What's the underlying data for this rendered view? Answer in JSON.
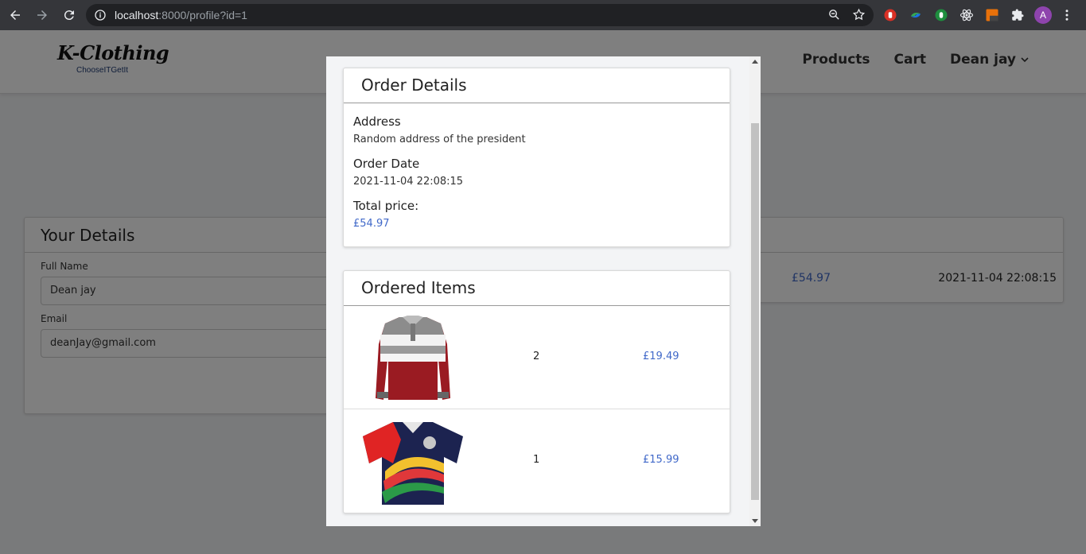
{
  "browser": {
    "url_host": "localhost",
    "url_rest": ":8000/profile?id=1",
    "avatar_letter": "A"
  },
  "site": {
    "logo_text": "K-Clothing",
    "logo_tagline": "ChooseITGetIt",
    "nav": {
      "products": "Products",
      "cart": "Cart",
      "user": "Dean jay"
    }
  },
  "your_details": {
    "title": "Your Details",
    "full_name_label": "Full Name",
    "full_name_value": "Dean jay",
    "email_label": "Email",
    "email_value": "deanJay@gmail.com"
  },
  "orders_table": {
    "row_price": "£54.97",
    "row_date": "2021-11-04 22:08:15"
  },
  "modal": {
    "order_details": {
      "title": "Order Details",
      "address_label": "Address",
      "address_value": "Random address of the president",
      "date_label": "Order Date",
      "date_value": "2021-11-04 22:08:15",
      "total_label": "Total price:",
      "total_value": "£54.97"
    },
    "ordered_items": {
      "title": "Ordered Items",
      "items": [
        {
          "qty": "2",
          "price": "£19.49"
        },
        {
          "qty": "1",
          "price": "£15.99"
        }
      ]
    }
  },
  "colors": {
    "accent_link": "#4169c9",
    "chrome_bg": "#35363a",
    "overlay": "rgba(0,0,0,0.5)"
  }
}
